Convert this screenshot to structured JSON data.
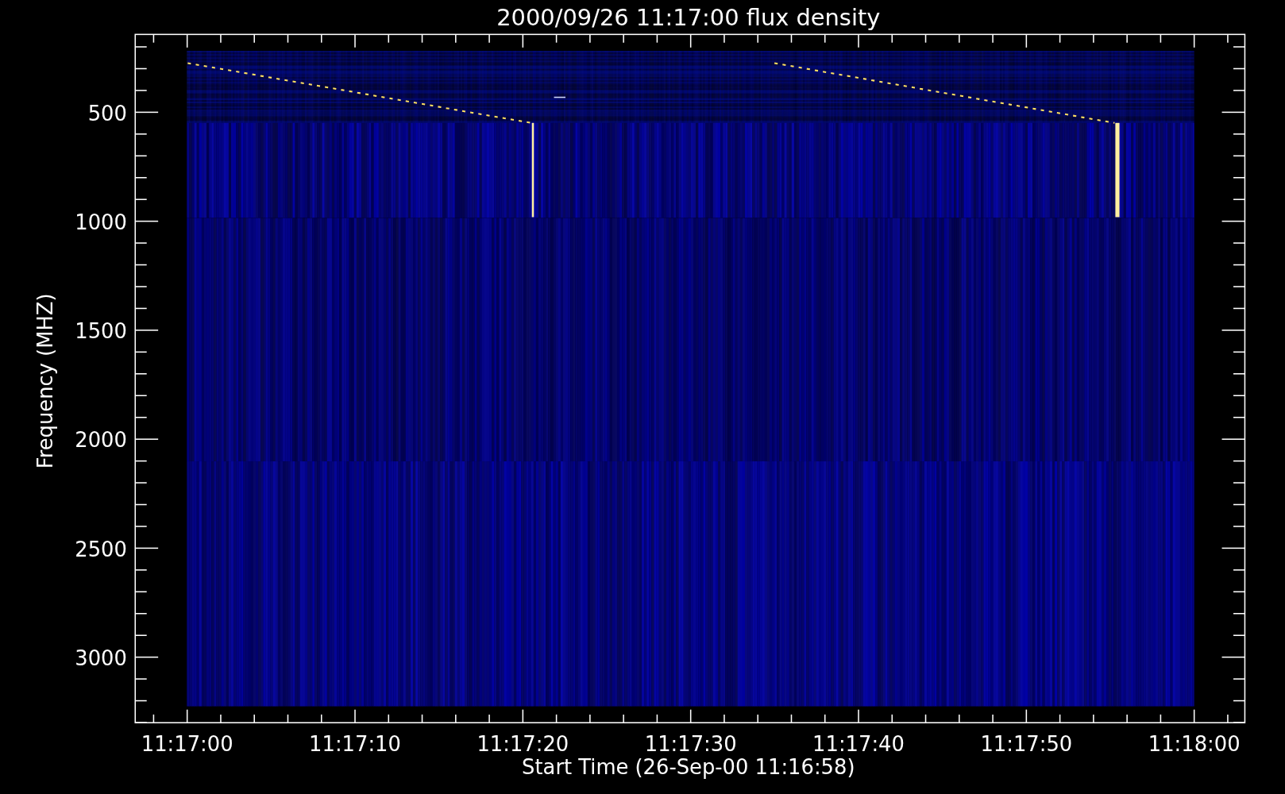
{
  "plot": {
    "title": "2000/09/26 11:17:00 flux density",
    "xlabel": "Start Time (26-Sep-00 11:16:58)",
    "ylabel": "Frequency (MHZ)",
    "xtick_labels": [
      "11:17:00",
      "11:17:10",
      "11:17:20",
      "11:17:30",
      "11:17:40",
      "11:17:50",
      "11:18:00"
    ],
    "ytick_labels": [
      "500",
      "1000",
      "1500",
      "2000",
      "2500",
      "3000"
    ]
  }
}
